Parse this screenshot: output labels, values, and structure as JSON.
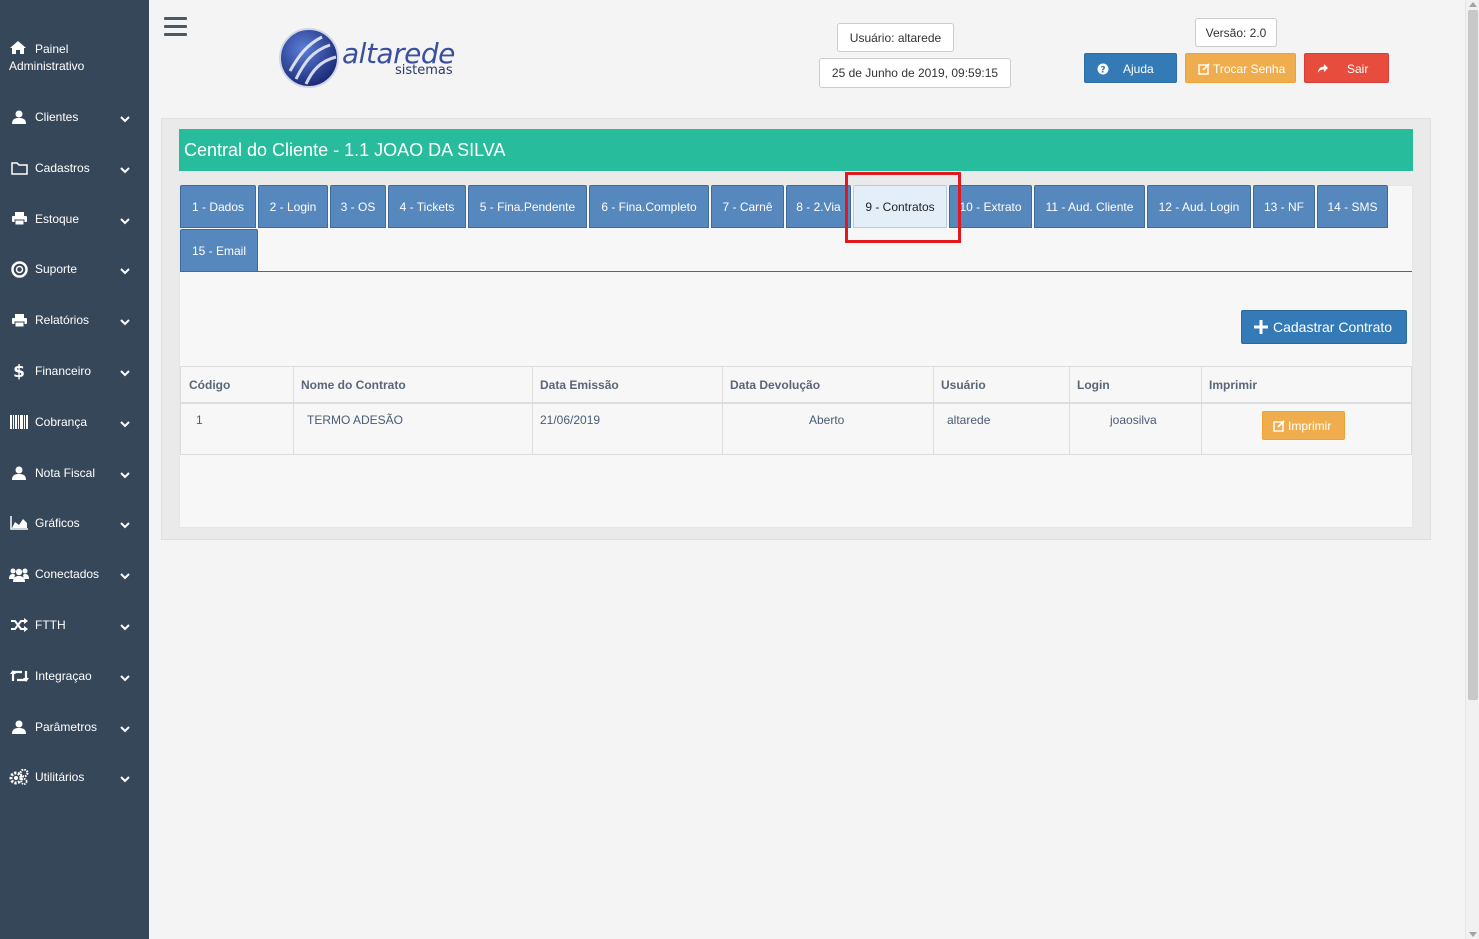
{
  "sidebar": {
    "home_line1": "Painel",
    "home_line2": "Administrativo",
    "items": [
      {
        "label": "Clientes",
        "icon": "user-icon"
      },
      {
        "label": "Cadastros",
        "icon": "folder-icon"
      },
      {
        "label": "Estoque",
        "icon": "printer-icon"
      },
      {
        "label": "Suporte",
        "icon": "life-ring-icon"
      },
      {
        "label": "Relatórios",
        "icon": "printer-icon"
      },
      {
        "label": "Financeiro",
        "icon": "dollar-icon"
      },
      {
        "label": "Cobrança",
        "icon": "barcode-icon"
      },
      {
        "label": "Nota Fiscal",
        "icon": "user-icon"
      },
      {
        "label": "Gráficos",
        "icon": "area-chart-icon"
      },
      {
        "label": "Conectados",
        "icon": "users-icon"
      },
      {
        "label": "FTTH",
        "icon": "shuffle-icon"
      },
      {
        "label": "Integraçao",
        "icon": "retweet-icon"
      },
      {
        "label": "Parâmetros",
        "icon": "user-icon"
      },
      {
        "label": "Utilitários",
        "icon": "cogs-icon"
      }
    ]
  },
  "header": {
    "logo_brand": "altarede",
    "logo_sub": "sistemas",
    "user": "Usuário: altarede",
    "datetime": "25 de Junho de 2019, 09:59:15",
    "version": "Versão: 2.0",
    "help": "Ajuda",
    "change_password": "Trocar Senha",
    "logout": "Sair"
  },
  "colors": {
    "sidebar": "#37475a",
    "title_bar": "#27bc9b",
    "tab": "#5687bd",
    "primary": "#337ab7",
    "warning": "#f0ad4e",
    "danger": "#e74c3c",
    "highlight": "#e2171f"
  },
  "page": {
    "title": "Central do Cliente - 1.1 JOAO DA SILVA",
    "tabs": [
      "1 - Dados",
      "2 - Login",
      "3 - OS",
      "4 - Tickets",
      "5 - Fina.Pendente",
      "6 - Fina.Completo",
      "7 - Carnê",
      "8 - 2.Via",
      "9 - Contratos",
      "10 - Extrato",
      "11 - Aud. Cliente",
      "12 - Aud. Login",
      "13 - NF",
      "14 - SMS",
      "15 - Email"
    ],
    "active_tab": "9 - Contratos",
    "add_button": "Cadastrar Contrato"
  },
  "table": {
    "columns": [
      "Código",
      "Nome do Contrato",
      "Data Emissão",
      "Data Devolução",
      "Usuário",
      "Login",
      "Imprimir"
    ],
    "rows": [
      {
        "codigo": "1",
        "nome": "TERMO ADESÃO",
        "emissao": "21/06/2019",
        "devolucao": "Aberto",
        "usuario": "altarede",
        "login": "joaosilva",
        "imprimir": "Imprimir"
      }
    ]
  }
}
